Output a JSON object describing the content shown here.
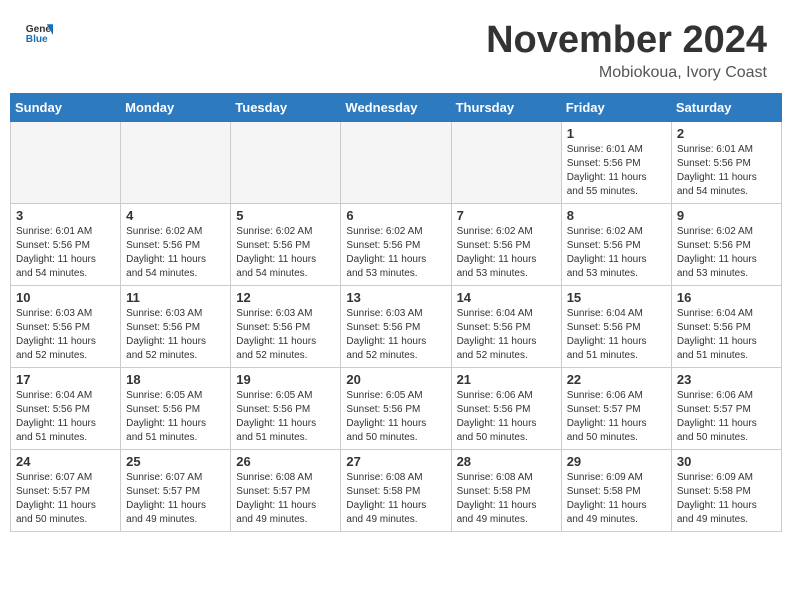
{
  "header": {
    "logo_line1": "General",
    "logo_line2": "Blue",
    "month_title": "November 2024",
    "location": "Mobiokoua, Ivory Coast"
  },
  "calendar": {
    "weekdays": [
      "Sunday",
      "Monday",
      "Tuesday",
      "Wednesday",
      "Thursday",
      "Friday",
      "Saturday"
    ],
    "weeks": [
      [
        {
          "day": "",
          "info": ""
        },
        {
          "day": "",
          "info": ""
        },
        {
          "day": "",
          "info": ""
        },
        {
          "day": "",
          "info": ""
        },
        {
          "day": "",
          "info": ""
        },
        {
          "day": "1",
          "info": "Sunrise: 6:01 AM\nSunset: 5:56 PM\nDaylight: 11 hours\nand 55 minutes."
        },
        {
          "day": "2",
          "info": "Sunrise: 6:01 AM\nSunset: 5:56 PM\nDaylight: 11 hours\nand 54 minutes."
        }
      ],
      [
        {
          "day": "3",
          "info": "Sunrise: 6:01 AM\nSunset: 5:56 PM\nDaylight: 11 hours\nand 54 minutes."
        },
        {
          "day": "4",
          "info": "Sunrise: 6:02 AM\nSunset: 5:56 PM\nDaylight: 11 hours\nand 54 minutes."
        },
        {
          "day": "5",
          "info": "Sunrise: 6:02 AM\nSunset: 5:56 PM\nDaylight: 11 hours\nand 54 minutes."
        },
        {
          "day": "6",
          "info": "Sunrise: 6:02 AM\nSunset: 5:56 PM\nDaylight: 11 hours\nand 53 minutes."
        },
        {
          "day": "7",
          "info": "Sunrise: 6:02 AM\nSunset: 5:56 PM\nDaylight: 11 hours\nand 53 minutes."
        },
        {
          "day": "8",
          "info": "Sunrise: 6:02 AM\nSunset: 5:56 PM\nDaylight: 11 hours\nand 53 minutes."
        },
        {
          "day": "9",
          "info": "Sunrise: 6:02 AM\nSunset: 5:56 PM\nDaylight: 11 hours\nand 53 minutes."
        }
      ],
      [
        {
          "day": "10",
          "info": "Sunrise: 6:03 AM\nSunset: 5:56 PM\nDaylight: 11 hours\nand 52 minutes."
        },
        {
          "day": "11",
          "info": "Sunrise: 6:03 AM\nSunset: 5:56 PM\nDaylight: 11 hours\nand 52 minutes."
        },
        {
          "day": "12",
          "info": "Sunrise: 6:03 AM\nSunset: 5:56 PM\nDaylight: 11 hours\nand 52 minutes."
        },
        {
          "day": "13",
          "info": "Sunrise: 6:03 AM\nSunset: 5:56 PM\nDaylight: 11 hours\nand 52 minutes."
        },
        {
          "day": "14",
          "info": "Sunrise: 6:04 AM\nSunset: 5:56 PM\nDaylight: 11 hours\nand 52 minutes."
        },
        {
          "day": "15",
          "info": "Sunrise: 6:04 AM\nSunset: 5:56 PM\nDaylight: 11 hours\nand 51 minutes."
        },
        {
          "day": "16",
          "info": "Sunrise: 6:04 AM\nSunset: 5:56 PM\nDaylight: 11 hours\nand 51 minutes."
        }
      ],
      [
        {
          "day": "17",
          "info": "Sunrise: 6:04 AM\nSunset: 5:56 PM\nDaylight: 11 hours\nand 51 minutes."
        },
        {
          "day": "18",
          "info": "Sunrise: 6:05 AM\nSunset: 5:56 PM\nDaylight: 11 hours\nand 51 minutes."
        },
        {
          "day": "19",
          "info": "Sunrise: 6:05 AM\nSunset: 5:56 PM\nDaylight: 11 hours\nand 51 minutes."
        },
        {
          "day": "20",
          "info": "Sunrise: 6:05 AM\nSunset: 5:56 PM\nDaylight: 11 hours\nand 50 minutes."
        },
        {
          "day": "21",
          "info": "Sunrise: 6:06 AM\nSunset: 5:56 PM\nDaylight: 11 hours\nand 50 minutes."
        },
        {
          "day": "22",
          "info": "Sunrise: 6:06 AM\nSunset: 5:57 PM\nDaylight: 11 hours\nand 50 minutes."
        },
        {
          "day": "23",
          "info": "Sunrise: 6:06 AM\nSunset: 5:57 PM\nDaylight: 11 hours\nand 50 minutes."
        }
      ],
      [
        {
          "day": "24",
          "info": "Sunrise: 6:07 AM\nSunset: 5:57 PM\nDaylight: 11 hours\nand 50 minutes."
        },
        {
          "day": "25",
          "info": "Sunrise: 6:07 AM\nSunset: 5:57 PM\nDaylight: 11 hours\nand 49 minutes."
        },
        {
          "day": "26",
          "info": "Sunrise: 6:08 AM\nSunset: 5:57 PM\nDaylight: 11 hours\nand 49 minutes."
        },
        {
          "day": "27",
          "info": "Sunrise: 6:08 AM\nSunset: 5:58 PM\nDaylight: 11 hours\nand 49 minutes."
        },
        {
          "day": "28",
          "info": "Sunrise: 6:08 AM\nSunset: 5:58 PM\nDaylight: 11 hours\nand 49 minutes."
        },
        {
          "day": "29",
          "info": "Sunrise: 6:09 AM\nSunset: 5:58 PM\nDaylight: 11 hours\nand 49 minutes."
        },
        {
          "day": "30",
          "info": "Sunrise: 6:09 AM\nSunset: 5:58 PM\nDaylight: 11 hours\nand 49 minutes."
        }
      ]
    ]
  }
}
